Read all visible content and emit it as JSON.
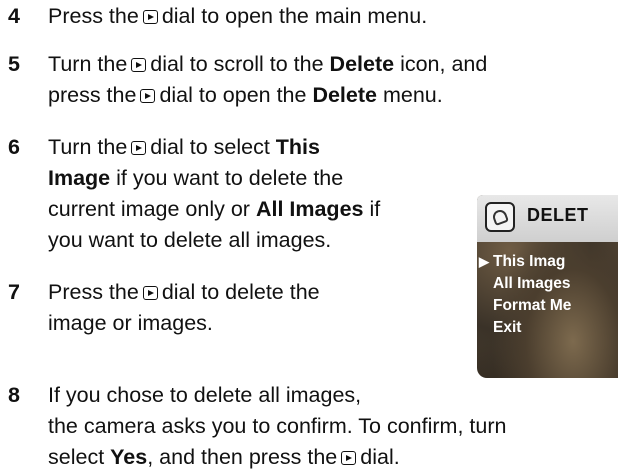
{
  "steps": [
    {
      "num": "4",
      "lines": [
        [
          "Press the",
          "dial",
          "dial to open the main menu."
        ]
      ]
    },
    {
      "num": "5",
      "line1": {
        "a": "Turn the",
        "b": "dial to scroll to the ",
        "bold": "Delete",
        "c": " icon, and"
      },
      "line2": {
        "a": "press the",
        "b": "dial to open the ",
        "bold": "Delete",
        "c": " menu."
      }
    },
    {
      "num": "6",
      "line1": {
        "a": "Turn the",
        "b": "dial to select ",
        "bold": "This"
      },
      "line2": {
        "bold": "Image",
        "c": " if you want to delete the"
      },
      "line3": {
        "a": "current image only or ",
        "bold": "All Images",
        "c": " if"
      },
      "line4": {
        "a": "you want to delete all images."
      }
    },
    {
      "num": "7",
      "line1": {
        "a": "Press the",
        "b": "dial to delete the"
      },
      "line2": {
        "a": "image or images."
      }
    },
    {
      "num": "8",
      "line1": {
        "a": "If you chose to delete all images,"
      },
      "line2": {
        "a": "the camera asks you to confirm. To confirm, turn"
      },
      "line3": {
        "a": "select ",
        "bold": "Yes",
        "c": ", and then press the",
        "d": "dial."
      }
    }
  ],
  "screen": {
    "title": "DELET",
    "menu": [
      "This Imag",
      "All Images",
      "Format Me",
      "Exit"
    ],
    "selected_index": 0,
    "icon": "delete-icon"
  }
}
